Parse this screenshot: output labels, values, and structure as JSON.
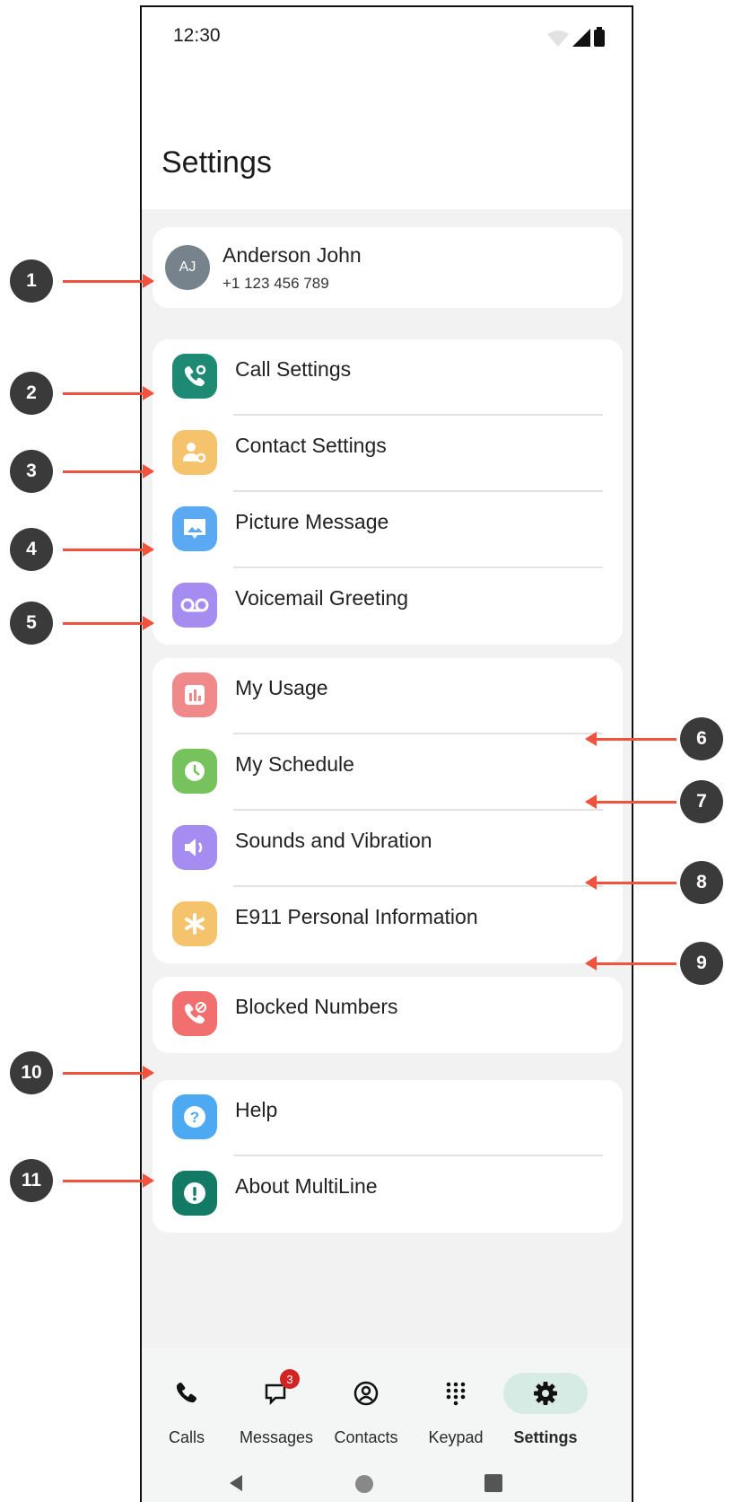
{
  "status_bar": {
    "time": "12:30"
  },
  "page_title": "Settings",
  "profile": {
    "initials": "AJ",
    "name": "Anderson John",
    "number": "+1 123 456 789"
  },
  "group1": [
    {
      "label": "Call Settings",
      "icon": "call-settings-icon",
      "color": "#1f8a74"
    },
    {
      "label": "Contact Settings",
      "icon": "contact-settings-icon",
      "color": "#f5c36b"
    },
    {
      "label": "Picture Message",
      "icon": "picture-message-icon",
      "color": "#5ba9f2"
    },
    {
      "label": "Voicemail Greeting",
      "icon": "voicemail-icon",
      "color": "#a58cf0"
    }
  ],
  "group2": [
    {
      "label": "My Usage",
      "icon": "usage-chart-icon",
      "color": "#f08a8a"
    },
    {
      "label": "My Schedule",
      "icon": "clock-icon",
      "color": "#76c25c"
    },
    {
      "label": "Sounds and Vibration",
      "icon": "speaker-icon",
      "color": "#a58cf0"
    },
    {
      "label": "E911 Personal Information",
      "icon": "asterisk-icon",
      "color": "#f5c36b"
    }
  ],
  "group3": [
    {
      "label": "Blocked Numbers",
      "icon": "blocked-call-icon",
      "color": "#f26f6f"
    }
  ],
  "group4": [
    {
      "label": "Help",
      "icon": "help-icon",
      "color": "#4da9f2"
    },
    {
      "label": "About MultiLine",
      "icon": "info-icon",
      "color": "#137a66"
    }
  ],
  "nav": [
    {
      "label": "Calls",
      "icon": "phone-icon"
    },
    {
      "label": "Messages",
      "icon": "message-icon",
      "badge": "3"
    },
    {
      "label": "Contacts",
      "icon": "contacts-icon"
    },
    {
      "label": "Keypad",
      "icon": "keypad-icon"
    },
    {
      "label": "Settings",
      "icon": "gear-icon",
      "active": true
    }
  ],
  "callouts": [
    "1",
    "2",
    "3",
    "4",
    "5",
    "6",
    "7",
    "8",
    "9",
    "10",
    "11"
  ],
  "colors": {
    "accent": "#f0523e",
    "nav_active_bg": "#d6ebe3",
    "callout": "#3a3a3a"
  }
}
